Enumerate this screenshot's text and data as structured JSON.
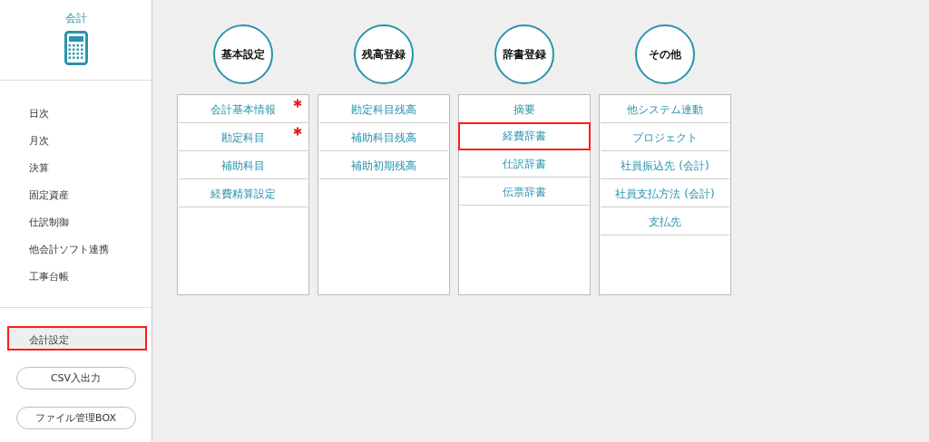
{
  "sidebar": {
    "title": "会計",
    "items": [
      {
        "label": "日次",
        "selected": false
      },
      {
        "label": "月次",
        "selected": false
      },
      {
        "label": "決算",
        "selected": false
      },
      {
        "label": "固定資産",
        "selected": false
      },
      {
        "label": "仕訳制御",
        "selected": false
      },
      {
        "label": "他会計ソフト連携",
        "selected": false
      },
      {
        "label": "工事台帳",
        "selected": false
      }
    ],
    "settings_item": {
      "label": "会計設定",
      "selected": true,
      "highlighted": true
    },
    "buttons": [
      "CSV入出力",
      "ファイル管理BOX"
    ]
  },
  "groups": [
    {
      "title": "基本設定",
      "items": [
        {
          "label": "会計基本情報",
          "required": true,
          "highlighted": false
        },
        {
          "label": "勘定科目",
          "required": true,
          "highlighted": false
        },
        {
          "label": "補助科目",
          "required": false,
          "highlighted": false
        },
        {
          "label": "経費精算設定",
          "required": false,
          "highlighted": false
        }
      ]
    },
    {
      "title": "残高登録",
      "items": [
        {
          "label": "勘定科目残高",
          "required": false,
          "highlighted": false
        },
        {
          "label": "補助科目残高",
          "required": false,
          "highlighted": false
        },
        {
          "label": "補助初期残高",
          "required": false,
          "highlighted": false
        }
      ]
    },
    {
      "title": "辞書登録",
      "items": [
        {
          "label": "摘要",
          "required": false,
          "highlighted": false
        },
        {
          "label": "経費辞書",
          "required": false,
          "highlighted": true
        },
        {
          "label": "仕訳辞書",
          "required": false,
          "highlighted": false
        },
        {
          "label": "伝票辞書",
          "required": false,
          "highlighted": false
        }
      ]
    },
    {
      "title": "その他",
      "items": [
        {
          "label": "他システム連動",
          "required": false,
          "highlighted": false
        },
        {
          "label": "プロジェクト",
          "required": false,
          "highlighted": false
        },
        {
          "label": "社員振込先 (会計)",
          "required": false,
          "highlighted": false
        },
        {
          "label": "社員支払方法 (会計)",
          "required": false,
          "highlighted": false
        },
        {
          "label": "支払先",
          "required": false,
          "highlighted": false
        }
      ]
    }
  ]
}
